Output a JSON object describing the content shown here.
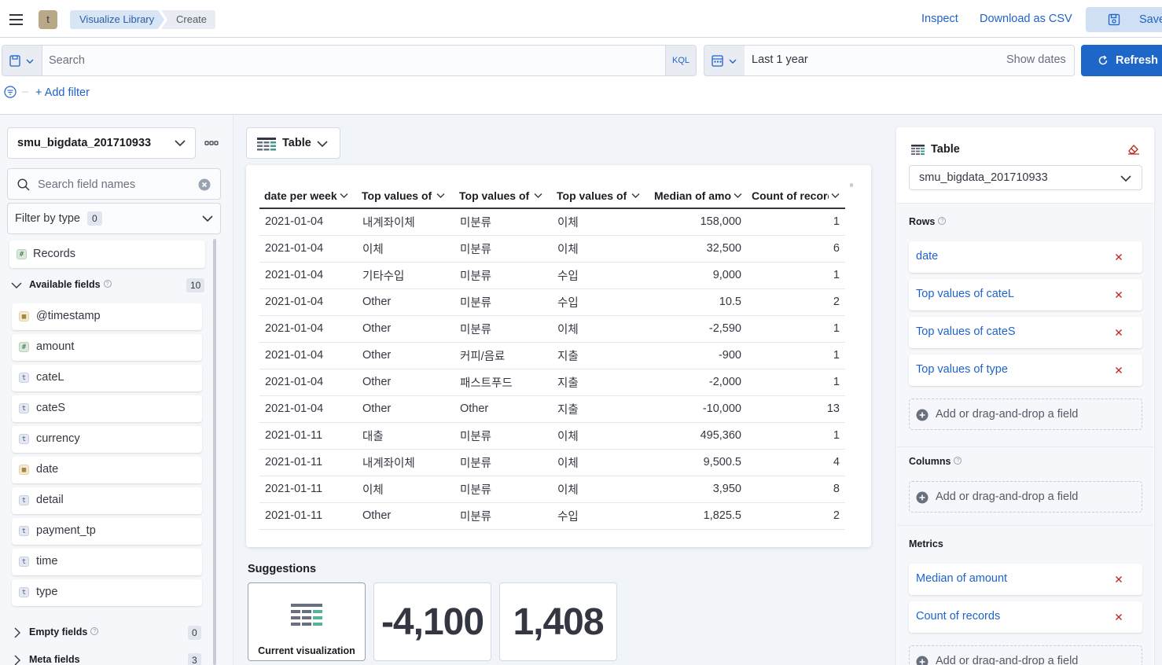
{
  "header": {
    "breadcrumbs": [
      "Visualize Library",
      "Create"
    ],
    "space_initial": "t",
    "inspect": "Inspect",
    "download_csv": "Download as CSV",
    "save": "Save"
  },
  "query_bar": {
    "search_placeholder": "Search",
    "language": "KQL",
    "date_range": "Last 1 year",
    "show_dates": "Show dates",
    "refresh": "Refresh",
    "add_filter": "+ Add filter"
  },
  "data_panel": {
    "index_pattern": "smu_bigdata_201710933",
    "field_search_placeholder": "Search field names",
    "filter_by_type": "Filter by type",
    "filter_count": "0",
    "records": "Records",
    "available_fields_label": "Available fields",
    "available_count": "10",
    "available_fields": [
      {
        "name": "@timestamp",
        "type": "date"
      },
      {
        "name": "amount",
        "type": "number"
      },
      {
        "name": "cateL",
        "type": "string"
      },
      {
        "name": "cateS",
        "type": "string"
      },
      {
        "name": "currency",
        "type": "string"
      },
      {
        "name": "date",
        "type": "date"
      },
      {
        "name": "detail",
        "type": "string"
      },
      {
        "name": "payment_tp",
        "type": "string"
      },
      {
        "name": "time",
        "type": "string"
      },
      {
        "name": "type",
        "type": "string"
      }
    ],
    "empty_fields_label": "Empty fields",
    "empty_count": "0",
    "meta_fields_label": "Meta fields",
    "meta_count": "3"
  },
  "workspace": {
    "chart_type": "Table",
    "table": {
      "columns": [
        "date per week",
        "Top values of cateL",
        "Top values of cateS",
        "Top values of type",
        "Median of amount",
        "Count of records"
      ],
      "rows": [
        [
          "2021-01-04",
          "내계좌이체",
          "미분류",
          "이체",
          "158,000",
          "1"
        ],
        [
          "2021-01-04",
          "이체",
          "미분류",
          "이체",
          "32,500",
          "6"
        ],
        [
          "2021-01-04",
          "기타수입",
          "미분류",
          "수입",
          "9,000",
          "1"
        ],
        [
          "2021-01-04",
          "Other",
          "미분류",
          "수입",
          "10.5",
          "2"
        ],
        [
          "2021-01-04",
          "Other",
          "미분류",
          "이체",
          "-2,590",
          "1"
        ],
        [
          "2021-01-04",
          "Other",
          "커피/음료",
          "지출",
          "-900",
          "1"
        ],
        [
          "2021-01-04",
          "Other",
          "패스트푸드",
          "지출",
          "-2,000",
          "1"
        ],
        [
          "2021-01-04",
          "Other",
          "Other",
          "지출",
          "-10,000",
          "13"
        ],
        [
          "2021-01-11",
          "대출",
          "미분류",
          "이체",
          "495,360",
          "1"
        ],
        [
          "2021-01-11",
          "내계좌이체",
          "미분류",
          "이체",
          "9,500.5",
          "4"
        ],
        [
          "2021-01-11",
          "이체",
          "미분류",
          "이체",
          "3,950",
          "8"
        ],
        [
          "2021-01-11",
          "Other",
          "미분류",
          "수입",
          "1,825.5",
          "2"
        ]
      ]
    },
    "suggestions_title": "Suggestions",
    "suggestions": [
      {
        "label": "Current visualization"
      },
      {
        "value": "-4,100"
      },
      {
        "value": "1,408"
      }
    ]
  },
  "config_panel": {
    "title": "Table",
    "index_pattern": "smu_bigdata_201710933",
    "rows_label": "Rows",
    "rows": [
      "date",
      "Top values of cateL",
      "Top values of cateS",
      "Top values of type"
    ],
    "columns_label": "Columns",
    "metrics_label": "Metrics",
    "metrics": [
      "Median of amount",
      "Count of records"
    ],
    "add_field": "Add or drag-and-drop a field"
  },
  "colors": {
    "accent": "#1e66c8",
    "link": "#1f63c8",
    "danger": "#bd271e"
  }
}
